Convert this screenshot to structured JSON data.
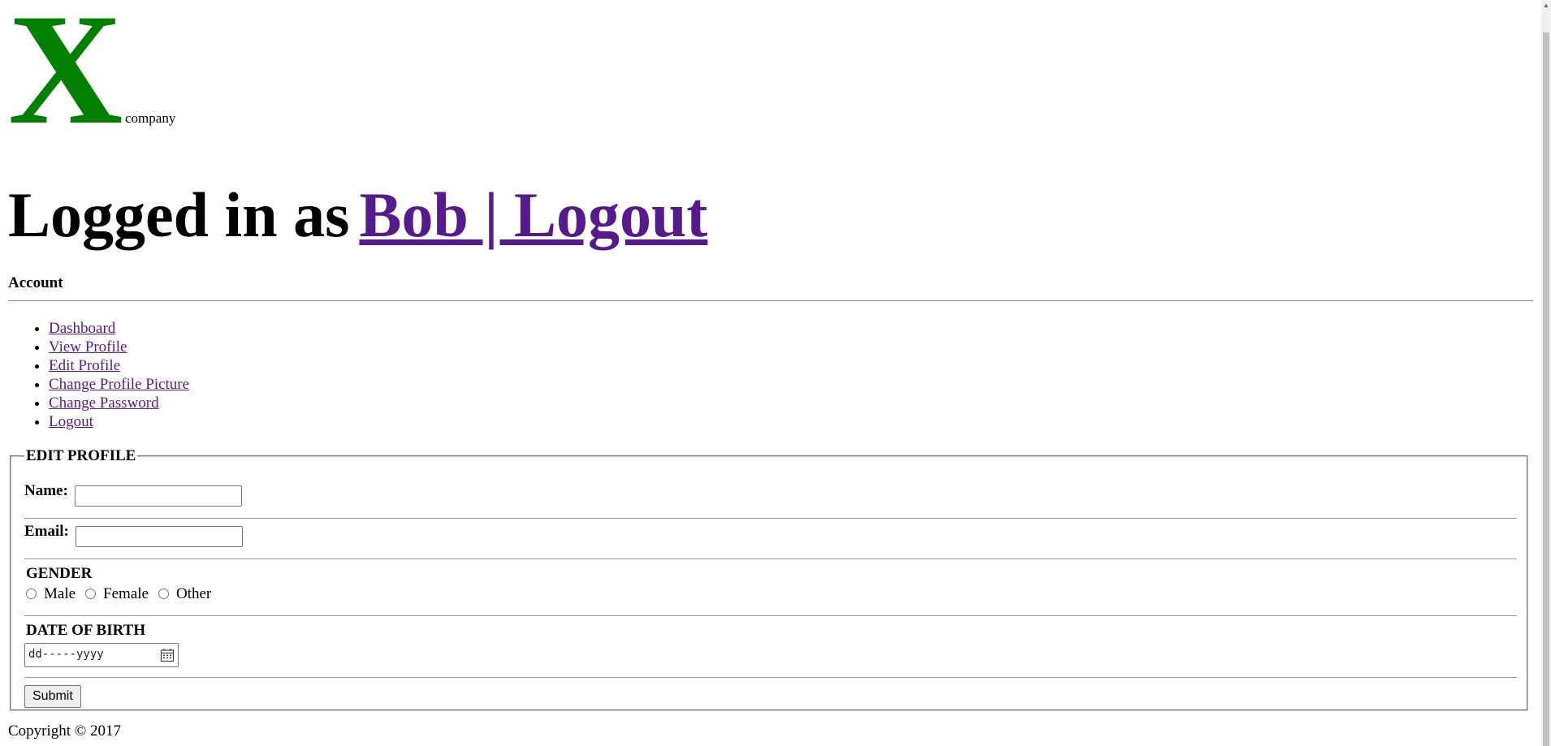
{
  "logo": {
    "letter": "X",
    "subtext": "company"
  },
  "header": {
    "logged_in_prefix": "Logged in as",
    "user_logout_link": "Bob | Logout"
  },
  "account": {
    "title": "Account",
    "nav": [
      {
        "label": "Dashboard"
      },
      {
        "label": "View Profile"
      },
      {
        "label": "Edit Profile"
      },
      {
        "label": "Change Profile Picture"
      },
      {
        "label": "Change Password"
      },
      {
        "label": "Logout"
      }
    ]
  },
  "form": {
    "legend": "EDIT PROFILE",
    "name_label": "Name:",
    "name_value": "",
    "email_label": "Email:",
    "email_value": "",
    "gender_heading": "GENDER",
    "gender_options": [
      "Male",
      "Female",
      "Other"
    ],
    "dob_heading": "DATE OF BIRTH",
    "dob_placeholder": "dd-----yyyy",
    "submit_label": "Submit"
  },
  "footer": {
    "copyright": "Copyright © 2017"
  },
  "colors": {
    "logo": "#008000",
    "link_visited": "#551a8b"
  }
}
